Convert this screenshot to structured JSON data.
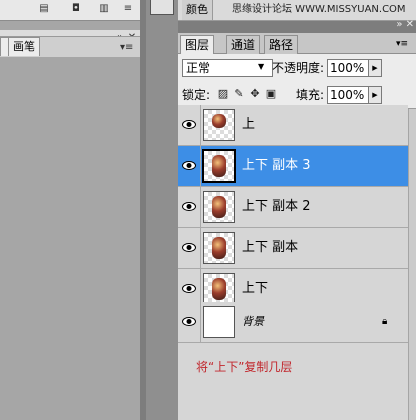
{
  "left_panel": {
    "tabs": [
      "画笔"
    ]
  },
  "color_panel": {
    "tab_label": "颜色",
    "watermark": "思缘设计论坛 WWW.MISSYUAN.COM"
  },
  "layers_panel": {
    "tabs": [
      "图层",
      "通道",
      "路径"
    ],
    "active_tab": "图层",
    "blend_mode": "正常",
    "opacity_label": "不透明度:",
    "opacity_value": "100%",
    "lock_label": "锁定:",
    "fill_label": "填充:",
    "fill_value": "100%",
    "layers": [
      {
        "name": "上",
        "selected": false
      },
      {
        "name": "上下 副本 3",
        "selected": true
      },
      {
        "name": "上下 副本 2",
        "selected": false
      },
      {
        "name": "上下 副本",
        "selected": false
      },
      {
        "name": "上下",
        "selected": false
      },
      {
        "name": "背景",
        "selected": false,
        "locked": true
      }
    ]
  },
  "note": "将“上下”复制几层",
  "colors": {
    "selection": "#3d8ee6",
    "note": "#c1272d"
  }
}
